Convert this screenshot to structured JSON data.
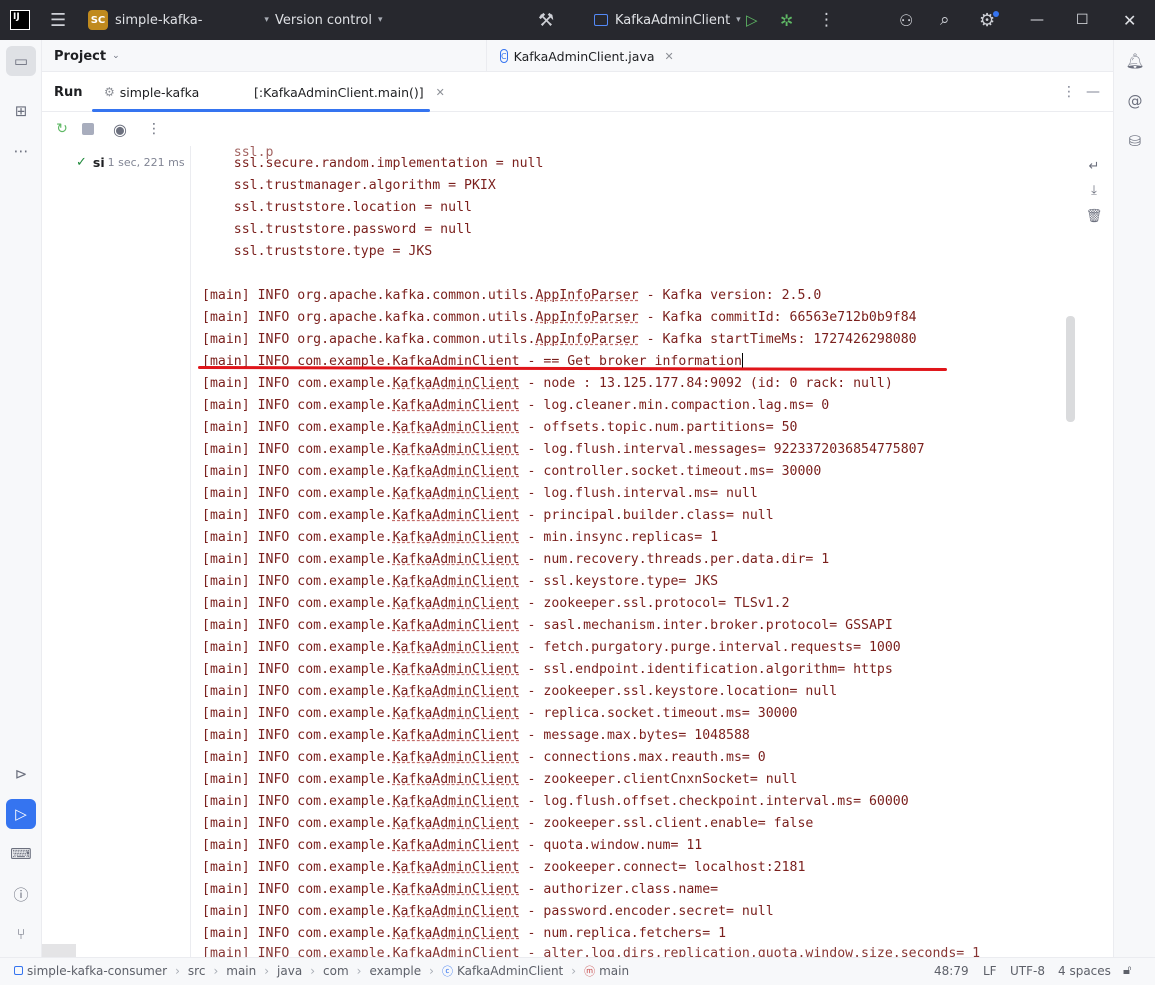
{
  "titlebar": {
    "logo_text": "IJ",
    "project_badge": "SC",
    "project_name": "simple-kafka-",
    "vcs_label": "Version control",
    "run_config": "KafkaAdminClient"
  },
  "project_panel": {
    "title": "Project"
  },
  "editor": {
    "tab_label": "KafkaAdminClient.java"
  },
  "run_window": {
    "label": "Run",
    "tabs": [
      {
        "label": "simple-kafka"
      },
      {
        "label": "[:KafkaAdminClient.main()]"
      }
    ]
  },
  "run_tree": {
    "name": "si",
    "time": "1 sec, 221 ms"
  },
  "console": {
    "lines": [
      {
        "pre": "    ssl.secure.random.implementation = null",
        "u": "",
        "post": ""
      },
      {
        "pre": "    ssl.trustmanager.algorithm = PKIX",
        "u": "",
        "post": ""
      },
      {
        "pre": "    ssl.truststore.location = null",
        "u": "",
        "post": ""
      },
      {
        "pre": "    ssl.truststore.password = null",
        "u": "",
        "post": ""
      },
      {
        "pre": "    ssl.truststore.type = JKS",
        "u": "",
        "post": ""
      },
      {
        "pre": "",
        "u": "",
        "post": ""
      },
      {
        "pre": "[main] INFO org.apache.kafka.common.utils.",
        "u": "AppInfoParser",
        "post": " - Kafka version: 2.5.0"
      },
      {
        "pre": "[main] INFO org.apache.kafka.common.utils.",
        "u": "AppInfoParser",
        "post": " - Kafka commitId: 66563e712b0b9f84"
      },
      {
        "pre": "[main] INFO org.apache.kafka.common.utils.",
        "u": "AppInfoParser",
        "post": " - Kafka startTimeMs: 1727426298080"
      },
      {
        "pre": "[main] INFO com.example.KafkaAdminClient - == Get broker information",
        "u": "",
        "post": ""
      },
      {
        "pre": "[main] INFO com.example.",
        "u": "KafkaAdminClient",
        "post": " - node : 13.125.177.84:9092 (id: 0 rack: null)"
      },
      {
        "pre": "[main] INFO com.example.",
        "u": "KafkaAdminClient",
        "post": " - log.cleaner.min.compaction.lag.ms= 0"
      },
      {
        "pre": "[main] INFO com.example.",
        "u": "KafkaAdminClient",
        "post": " - offsets.topic.num.partitions= 50"
      },
      {
        "pre": "[main] INFO com.example.",
        "u": "KafkaAdminClient",
        "post": " - log.flush.interval.messages= 9223372036854775807"
      },
      {
        "pre": "[main] INFO com.example.",
        "u": "KafkaAdminClient",
        "post": " - controller.socket.timeout.ms= 30000"
      },
      {
        "pre": "[main] INFO com.example.",
        "u": "KafkaAdminClient",
        "post": " - log.flush.interval.ms= null"
      },
      {
        "pre": "[main] INFO com.example.",
        "u": "KafkaAdminClient",
        "post": " - principal.builder.class= null"
      },
      {
        "pre": "[main] INFO com.example.",
        "u": "KafkaAdminClient",
        "post": " - min.insync.replicas= 1"
      },
      {
        "pre": "[main] INFO com.example.",
        "u": "KafkaAdminClient",
        "post": " - num.recovery.threads.per.data.dir= 1"
      },
      {
        "pre": "[main] INFO com.example.",
        "u": "KafkaAdminClient",
        "post": " - ssl.keystore.type= JKS"
      },
      {
        "pre": "[main] INFO com.example.",
        "u": "KafkaAdminClient",
        "post": " - zookeeper.ssl.protocol= TLSv1.2"
      },
      {
        "pre": "[main] INFO com.example.",
        "u": "KafkaAdminClient",
        "post": " - sasl.mechanism.inter.broker.protocol= GSSAPI"
      },
      {
        "pre": "[main] INFO com.example.",
        "u": "KafkaAdminClient",
        "post": " - fetch.purgatory.purge.interval.requests= 1000"
      },
      {
        "pre": "[main] INFO com.example.",
        "u": "KafkaAdminClient",
        "post": " - ssl.endpoint.identification.algorithm= https"
      },
      {
        "pre": "[main] INFO com.example.",
        "u": "KafkaAdminClient",
        "post": " - zookeeper.ssl.keystore.location= null"
      },
      {
        "pre": "[main] INFO com.example.",
        "u": "KafkaAdminClient",
        "post": " - replica.socket.timeout.ms= 30000"
      },
      {
        "pre": "[main] INFO com.example.",
        "u": "KafkaAdminClient",
        "post": " - message.max.bytes= 1048588"
      },
      {
        "pre": "[main] INFO com.example.",
        "u": "KafkaAdminClient",
        "post": " - connections.max.reauth.ms= 0"
      },
      {
        "pre": "[main] INFO com.example.",
        "u": "KafkaAdminClient",
        "post": " - zookeeper.clientCnxnSocket= null"
      },
      {
        "pre": "[main] INFO com.example.",
        "u": "KafkaAdminClient",
        "post": " - log.flush.offset.checkpoint.interval.ms= 60000"
      },
      {
        "pre": "[main] INFO com.example.",
        "u": "KafkaAdminClient",
        "post": " - zookeeper.ssl.client.enable= false"
      },
      {
        "pre": "[main] INFO com.example.",
        "u": "KafkaAdminClient",
        "post": " - quota.window.num= 11"
      },
      {
        "pre": "[main] INFO com.example.",
        "u": "KafkaAdminClient",
        "post": " - zookeeper.connect= localhost:2181"
      },
      {
        "pre": "[main] INFO com.example.",
        "u": "KafkaAdminClient",
        "post": " - authorizer.class.name="
      },
      {
        "pre": "[main] INFO com.example.",
        "u": "KafkaAdminClient",
        "post": " - password.encoder.secret= null"
      },
      {
        "pre": "[main] INFO com.example.",
        "u": "KafkaAdminClient",
        "post": " - num.replica.fetchers= 1"
      }
    ]
  },
  "statusbar": {
    "breadcrumbs": [
      "simple-kafka-consumer",
      "src",
      "main",
      "java",
      "com",
      "example",
      "KafkaAdminClient",
      "main"
    ],
    "position": "48:79",
    "line_sep": "LF",
    "encoding": "UTF-8",
    "indent": "4 spaces"
  },
  "colors": {
    "console_text": "#7a1f1c",
    "highlight_mark": "#e0151a",
    "accent": "#3574f0",
    "success": "#208a3c"
  }
}
